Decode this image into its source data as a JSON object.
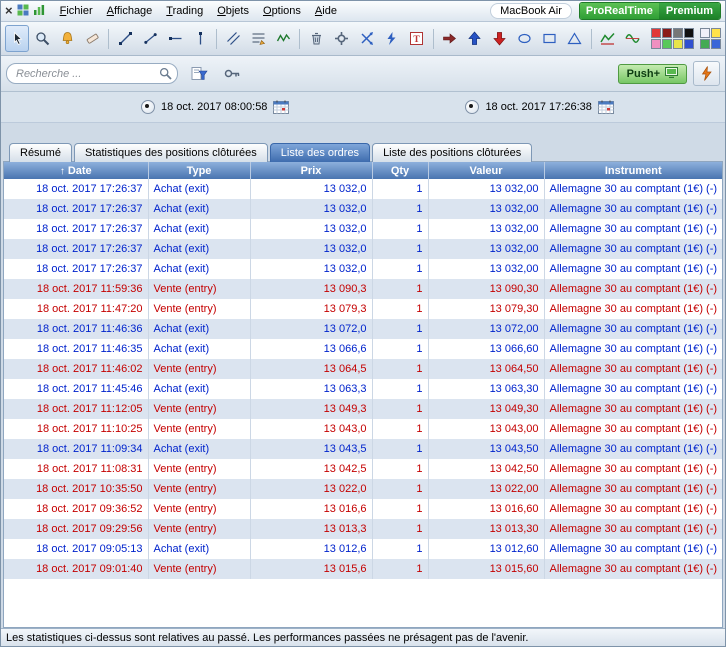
{
  "window": {
    "menu_items": [
      "Fichier",
      "Affichage",
      "Trading",
      "Objets",
      "Options",
      "Aide"
    ],
    "device": "MacBook Air",
    "brand": "ProRealTime",
    "edition": "Premium"
  },
  "icons": {
    "close": "×",
    "sort_ascending": "↑"
  },
  "toolbar": {
    "tools": [
      "pointer-tool",
      "zoom-tool",
      "alerts-tool",
      "eraser-tool",
      "trend-line-tool",
      "segment-tool",
      "horizontal-line-tool",
      "vertical-line-tool",
      "channel-tool",
      "fibonacci-tool",
      "zigzag-tool",
      "delete-tool",
      "settings-tool",
      "cross-arrows-tool",
      "flash-tool",
      "text-tool",
      "arrow-right-tool",
      "arrow-up-tool",
      "arrow-down-tool",
      "ellipse-tool",
      "rectangle-tool",
      "triangle-tool",
      "indicator-updown-tool",
      "indicator-wave-tool"
    ],
    "palette_main": [
      "#e03838",
      "#8a1a1a",
      "#777777",
      "#111111",
      "#f090c0",
      "#58c85a",
      "#e8e44a",
      "#3050d0"
    ],
    "palette_small": [
      "#f0f0f8",
      "#ffe24a",
      "#44aa55",
      "#3a66d8"
    ]
  },
  "search": {
    "placeholder": "Recherche ...",
    "push_label": "Push+"
  },
  "period": {
    "start": "18 oct. 2017 08:00:58",
    "end": "18 oct. 2017 17:26:38"
  },
  "tabs": [
    {
      "label": "Résumé",
      "active": false
    },
    {
      "label": "Statistiques des positions clôturées",
      "active": false
    },
    {
      "label": "Liste des ordres",
      "active": true
    },
    {
      "label": "Liste des positions clôturées",
      "active": false
    }
  ],
  "table": {
    "columns": [
      "Date",
      "Type",
      "Prix",
      "Qty",
      "Valeur",
      "Instrument"
    ],
    "sorted_column": "Date",
    "rows": [
      {
        "date": "18 oct. 2017 17:26:37",
        "type": "Achat (exit)",
        "prix": "13 032,0",
        "qty": "1",
        "valeur": "13 032,00",
        "instrument": "Allemagne 30 au comptant (1€) (-)",
        "side": "achat"
      },
      {
        "date": "18 oct. 2017 17:26:37",
        "type": "Achat (exit)",
        "prix": "13 032,0",
        "qty": "1",
        "valeur": "13 032,00",
        "instrument": "Allemagne 30 au comptant (1€) (-)",
        "side": "achat"
      },
      {
        "date": "18 oct. 2017 17:26:37",
        "type": "Achat (exit)",
        "prix": "13 032,0",
        "qty": "1",
        "valeur": "13 032,00",
        "instrument": "Allemagne 30 au comptant (1€) (-)",
        "side": "achat"
      },
      {
        "date": "18 oct. 2017 17:26:37",
        "type": "Achat (exit)",
        "prix": "13 032,0",
        "qty": "1",
        "valeur": "13 032,00",
        "instrument": "Allemagne 30 au comptant (1€) (-)",
        "side": "achat"
      },
      {
        "date": "18 oct. 2017 17:26:37",
        "type": "Achat (exit)",
        "prix": "13 032,0",
        "qty": "1",
        "valeur": "13 032,00",
        "instrument": "Allemagne 30 au comptant (1€) (-)",
        "side": "achat"
      },
      {
        "date": "18 oct. 2017 11:59:36",
        "type": "Vente (entry)",
        "prix": "13 090,3",
        "qty": "1",
        "valeur": "13 090,30",
        "instrument": "Allemagne 30 au comptant (1€) (-)",
        "side": "vente"
      },
      {
        "date": "18 oct. 2017 11:47:20",
        "type": "Vente (entry)",
        "prix": "13 079,3",
        "qty": "1",
        "valeur": "13 079,30",
        "instrument": "Allemagne 30 au comptant (1€) (-)",
        "side": "vente"
      },
      {
        "date": "18 oct. 2017 11:46:36",
        "type": "Achat (exit)",
        "prix": "13 072,0",
        "qty": "1",
        "valeur": "13 072,00",
        "instrument": "Allemagne 30 au comptant (1€) (-)",
        "side": "achat"
      },
      {
        "date": "18 oct. 2017 11:46:35",
        "type": "Achat (exit)",
        "prix": "13 066,6",
        "qty": "1",
        "valeur": "13 066,60",
        "instrument": "Allemagne 30 au comptant (1€) (-)",
        "side": "achat"
      },
      {
        "date": "18 oct. 2017 11:46:02",
        "type": "Vente (entry)",
        "prix": "13 064,5",
        "qty": "1",
        "valeur": "13 064,50",
        "instrument": "Allemagne 30 au comptant (1€) (-)",
        "side": "vente"
      },
      {
        "date": "18 oct. 2017 11:45:46",
        "type": "Achat (exit)",
        "prix": "13 063,3",
        "qty": "1",
        "valeur": "13 063,30",
        "instrument": "Allemagne 30 au comptant (1€) (-)",
        "side": "achat"
      },
      {
        "date": "18 oct. 2017 11:12:05",
        "type": "Vente (entry)",
        "prix": "13 049,3",
        "qty": "1",
        "valeur": "13 049,30",
        "instrument": "Allemagne 30 au comptant (1€) (-)",
        "side": "vente"
      },
      {
        "date": "18 oct. 2017 11:10:25",
        "type": "Vente (entry)",
        "prix": "13 043,0",
        "qty": "1",
        "valeur": "13 043,00",
        "instrument": "Allemagne 30 au comptant (1€) (-)",
        "side": "vente"
      },
      {
        "date": "18 oct. 2017 11:09:34",
        "type": "Achat (exit)",
        "prix": "13 043,5",
        "qty": "1",
        "valeur": "13 043,50",
        "instrument": "Allemagne 30 au comptant (1€) (-)",
        "side": "achat"
      },
      {
        "date": "18 oct. 2017 11:08:31",
        "type": "Vente (entry)",
        "prix": "13 042,5",
        "qty": "1",
        "valeur": "13 042,50",
        "instrument": "Allemagne 30 au comptant (1€) (-)",
        "side": "vente"
      },
      {
        "date": "18 oct. 2017 10:35:50",
        "type": "Vente (entry)",
        "prix": "13 022,0",
        "qty": "1",
        "valeur": "13 022,00",
        "instrument": "Allemagne 30 au comptant (1€) (-)",
        "side": "vente"
      },
      {
        "date": "18 oct. 2017 09:36:52",
        "type": "Vente (entry)",
        "prix": "13 016,6",
        "qty": "1",
        "valeur": "13 016,60",
        "instrument": "Allemagne 30 au comptant (1€) (-)",
        "side": "vente"
      },
      {
        "date": "18 oct. 2017 09:29:56",
        "type": "Vente (entry)",
        "prix": "13 013,3",
        "qty": "1",
        "valeur": "13 013,30",
        "instrument": "Allemagne 30 au comptant (1€) (-)",
        "side": "vente"
      },
      {
        "date": "18 oct. 2017 09:05:13",
        "type": "Achat (exit)",
        "prix": "13 012,6",
        "qty": "1",
        "valeur": "13 012,60",
        "instrument": "Allemagne 30 au comptant (1€) (-)",
        "side": "achat"
      },
      {
        "date": "18 oct. 2017 09:01:40",
        "type": "Vente (entry)",
        "prix": "13 015,6",
        "qty": "1",
        "valeur": "13 015,60",
        "instrument": "Allemagne 30 au comptant (1€) (-)",
        "side": "vente"
      }
    ]
  },
  "footer": {
    "disclaimer": "Les statistiques ci-dessus sont relatives au passé. Les performances passées ne présagent pas de l'avenir."
  },
  "colors": {
    "achat_text": "#0023cc",
    "vente_text": "#c40000",
    "header_top": "#8db0dc",
    "header_bottom": "#4974b0",
    "row_alternate": "#dbe4f0",
    "brand_green": "#2f9e35"
  }
}
